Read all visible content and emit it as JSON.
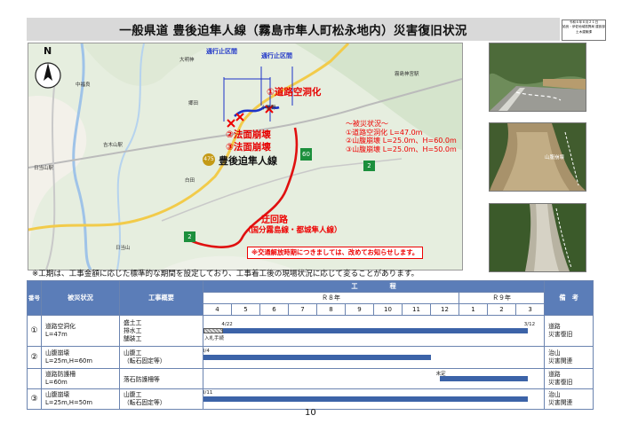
{
  "title": "一般県道 豊後迫隼人線（霧島市隼人町松永地内）災害復旧状況",
  "stamp": [
    "令和６年６月２１日",
    "姶良・伊佐地域振興局 建設部",
    "土木建築課"
  ],
  "map": {
    "north_label": "N",
    "closure_label_1": "通行止区間",
    "closure_label_2": "通行止区間",
    "site_1": "①道路空洞化",
    "site_2": "②法面崩壊",
    "site_3": "③法面崩壊",
    "route_name": "豊後迫隼人線",
    "route_shield": "475",
    "shield_60": "60",
    "shield_2a": "2",
    "shield_2b": "2",
    "damage_title": "～被災状況～",
    "damage_1": "①道路空洞化 L=47.0m",
    "damage_2": "②山腹崩壊 L=25.0m、H=60.0m",
    "damage_3": "③山腹崩壊 L=25.0m、H=50.0m",
    "detour_title": "迂回路",
    "detour_sub": "（国分霧島線・都城隼人線）",
    "notice": "※交通解放時期につきましては、改めてお知らせします。",
    "place_names": [
      "大明神",
      "霧島神宮駅",
      "中福良",
      "郷田",
      "吉木山駅",
      "日当山駅",
      "白田",
      "日当山",
      "小屋野"
    ]
  },
  "photos": {
    "labels": [
      "①",
      "②",
      "③"
    ],
    "caption_2": "山腹崩壊"
  },
  "note": "※工期は、工事金額に応じた標準的な期間を設定しており、工事着工後の現場状況に応じて変ることがあります。",
  "table": {
    "h_no": "番号",
    "h_damage": "被災状況",
    "h_work": "工事概要",
    "h_schedule": "工　　　　　程",
    "h_r8": "Ｒ８年",
    "h_r9": "Ｒ９年",
    "h_note": "備　考",
    "months": [
      "4",
      "5",
      "6",
      "7",
      "8",
      "9",
      "10",
      "11",
      "12",
      "1",
      "2",
      "3"
    ],
    "rows": [
      {
        "no": "①",
        "damage": [
          "道路空洞化",
          "L=47m"
        ],
        "work": [
          "盛土工",
          "排水工",
          "舗装工"
        ],
        "start_label": "4/22",
        "end_label": "3/12",
        "pre_label": "入札手続",
        "note": [
          "道路",
          "災害復旧"
        ],
        "bar_start": 4.7,
        "bar_end": 15.4,
        "pre_start": 4.0,
        "pre_end": 4.7
      },
      {
        "no": "②",
        "damage": [
          "山腹崩壊",
          "L=25m,H=60m"
        ],
        "work": [
          "山腹工",
          "（転石固定等）"
        ],
        "start_label": "3/4",
        "note": [
          "治山",
          "災害関連"
        ],
        "bar_start": 4.0,
        "bar_end": 12.0
      },
      {
        "no": "",
        "damage": [
          "道路防護柵",
          "L=60m"
        ],
        "work": [
          "落石防護柵等"
        ],
        "mid_label": "未定",
        "note": [
          "道路",
          "災害復旧"
        ],
        "bar_start": 12.3,
        "bar_end": 15.4
      },
      {
        "no": "③",
        "damage": [
          "山腹崩壊",
          "L=25m,H=50m"
        ],
        "work": [
          "山腹工",
          "（転石固定等）"
        ],
        "start_label": "3/11",
        "note": [
          "治山",
          "災害関連"
        ],
        "bar_start": 4.0,
        "bar_end": 15.4
      }
    ]
  },
  "page_number": "10",
  "colors": {
    "header_blue": "#5b7db8",
    "bar_blue": "#3c63a8",
    "accent_red": "#e60000"
  }
}
